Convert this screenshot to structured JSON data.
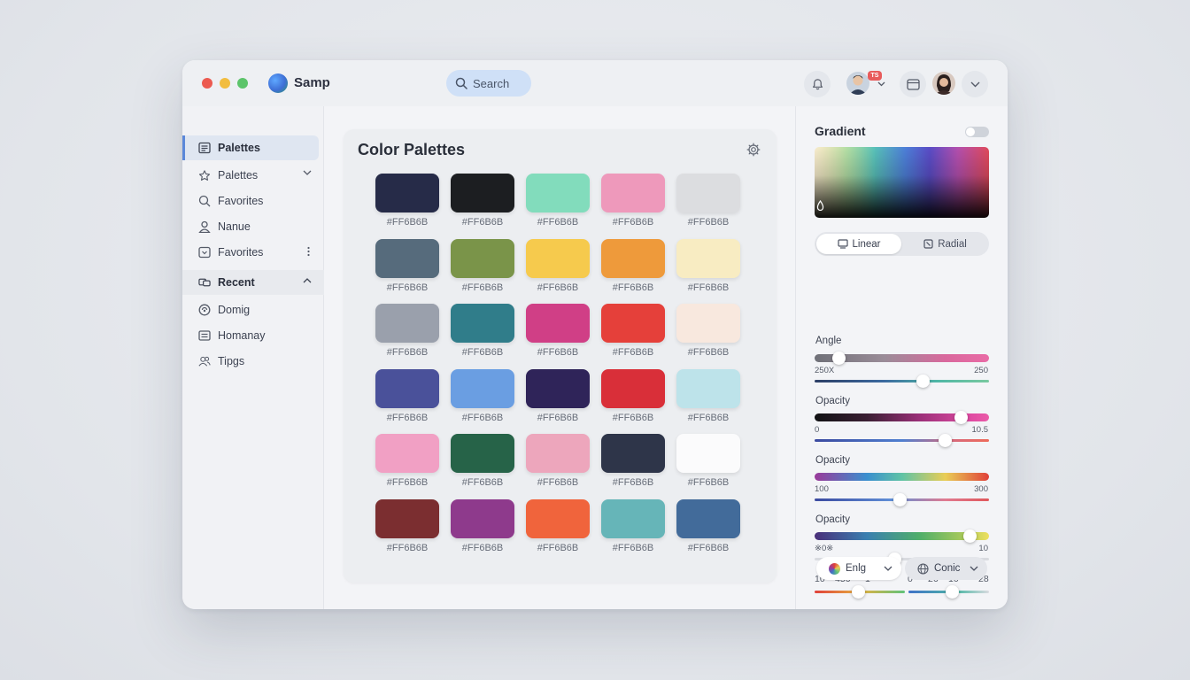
{
  "window": {
    "app_name": "Samp"
  },
  "header": {
    "search_placeholder": "Search",
    "notification_badge": "TS"
  },
  "sidebar": {
    "items": [
      {
        "label": "Palettes"
      },
      {
        "label": "Palettes"
      },
      {
        "label": "Favorites"
      },
      {
        "label": "Nanue"
      },
      {
        "label": "Favorites"
      }
    ],
    "section_label": "Recent",
    "recent": [
      {
        "label": "Domig"
      },
      {
        "label": "Homanay"
      },
      {
        "label": "Tipgs"
      }
    ]
  },
  "main": {
    "title": "Color Palettes",
    "swatches": [
      {
        "color": "#262b48",
        "hex": "#FF6B6B"
      },
      {
        "color": "#1c1e21",
        "hex": "#FF6B6B"
      },
      {
        "color": "#82dcbc",
        "hex": "#FF6B6B"
      },
      {
        "color": "#ee99bb",
        "hex": "#FF6B6B"
      },
      {
        "color": "#dcdde0",
        "hex": "#FF6B6B"
      },
      {
        "color": "#566b7c",
        "hex": "#FF6B6B"
      },
      {
        "color": "#7a9449",
        "hex": "#FF6B6B"
      },
      {
        "color": "#f6ca4d",
        "hex": "#FF6B6B"
      },
      {
        "color": "#ee9a3b",
        "hex": "#FF6B6B"
      },
      {
        "color": "#f8ecc2",
        "hex": "#FF6B6B"
      },
      {
        "color": "#9aa0ac",
        "hex": "#FF6B6B"
      },
      {
        "color": "#307d8a",
        "hex": "#FF6B6B"
      },
      {
        "color": "#d03f86",
        "hex": "#FF6B6B"
      },
      {
        "color": "#e5403a",
        "hex": "#FF6B6B"
      },
      {
        "color": "#f8e8de",
        "hex": "#FF6B6B"
      },
      {
        "color": "#4a519a",
        "hex": "#FF6B6B"
      },
      {
        "color": "#6a9ee2",
        "hex": "#FF6B6B"
      },
      {
        "color": "#2f2459",
        "hex": "#FF6B6B"
      },
      {
        "color": "#d92f39",
        "hex": "#FF6B6B"
      },
      {
        "color": "#bde3ea",
        "hex": "#FF6B6B"
      },
      {
        "color": "#f1a0c4",
        "hex": "#FF6B6B"
      },
      {
        "color": "#266348",
        "hex": "#FF6B6B"
      },
      {
        "color": "#eda6bc",
        "hex": "#FF6B6B"
      },
      {
        "color": "#2e3549",
        "hex": "#FF6B6B"
      },
      {
        "color": "#fbfbfc",
        "hex": "#FF6B6B"
      },
      {
        "color": "#7b2e30",
        "hex": "#FF6B6B"
      },
      {
        "color": "#8e3a8c",
        "hex": "#FF6B6B"
      },
      {
        "color": "#f0643c",
        "hex": "#FF6B6B"
      },
      {
        "color": "#66b5b8",
        "hex": "#FF6B6B"
      },
      {
        "color": "#426b9a",
        "hex": "#FF6B6B"
      }
    ]
  },
  "gradient_panel": {
    "title": "Gradient",
    "toggle_on": false,
    "modes": [
      {
        "label": "Linear",
        "selected": true
      },
      {
        "label": "Radial",
        "selected": false
      }
    ],
    "sliders": [
      {
        "label": "Angle",
        "value": 0.14,
        "min_label": "250X",
        "max_label": "250",
        "sub_value": 0.62
      },
      {
        "label": "Opacity",
        "value": 0.84,
        "min_label": "0",
        "max_label": "10.5",
        "sub_value": 0.75
      },
      {
        "label": "Opacity",
        "value": 0.49,
        "min_label": "100",
        "max_label": "300",
        "sub_value": null
      },
      {
        "label": "Opacity",
        "value": 0.89,
        "min_label": "※0※",
        "max_label": "10",
        "sub_value": 0.46
      }
    ],
    "stops": [
      "10",
      "456",
      "1",
      "0",
      "26",
      "10",
      "28"
    ],
    "stop_positions": [
      0.25,
      0.79
    ],
    "dropdowns": [
      {
        "label": "Enlg"
      },
      {
        "label": "Conic"
      }
    ]
  }
}
